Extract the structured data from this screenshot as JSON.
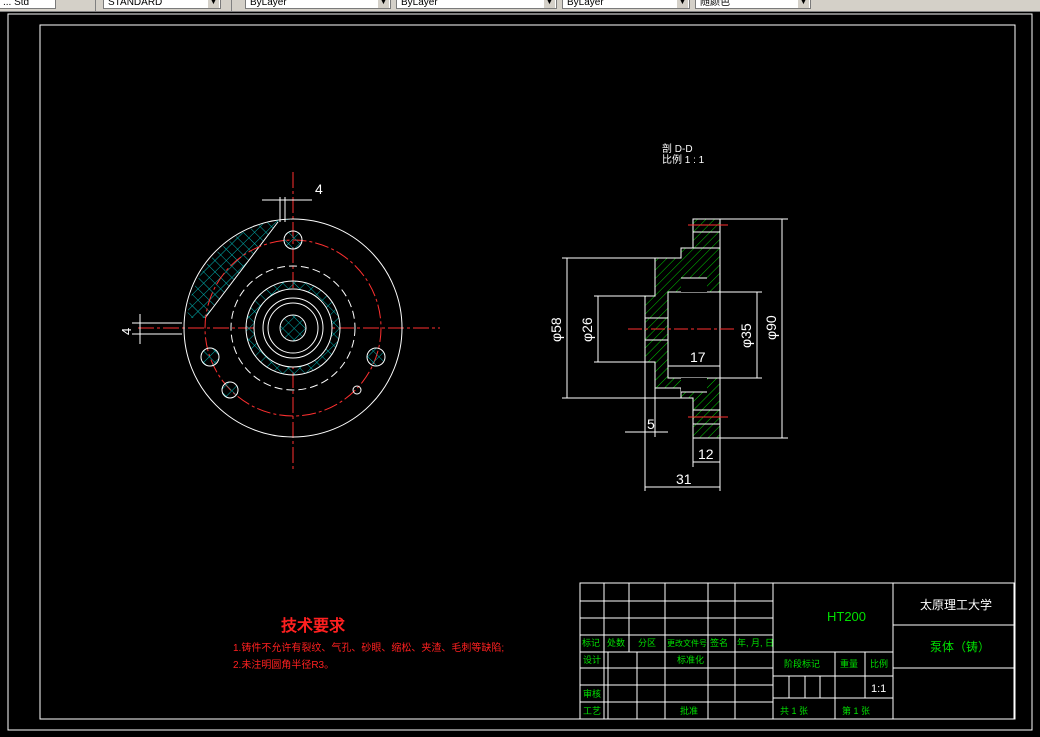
{
  "toolbar": {
    "items": [
      {
        "label": "... Std"
      },
      {
        "label": "STANDARD"
      },
      {
        "label": "ByLayer"
      },
      {
        "label": "ByLayer"
      },
      {
        "label": "ByLayer"
      },
      {
        "label": "随颜色"
      }
    ]
  },
  "drawing": {
    "section_title": "剖 D-D",
    "section_scale": "比例 1 : 1",
    "dims": {
      "d4_top": "4",
      "d4_left": "4",
      "phi58": "φ58",
      "phi26": "φ26",
      "phi35": "φ35",
      "phi90": "φ90",
      "d17": "17",
      "d5": "5",
      "d12": "12",
      "d31": "31"
    },
    "tech": {
      "title": "技术要求",
      "line1": "1.铸件不允许有裂纹、气孔、砂眼、缩松、夹渣、毛刺等缺陷;",
      "line2": "2.未注明圆角半径R3。"
    }
  },
  "titleblock": {
    "material": "HT200",
    "school": "太原理工大学",
    "part_name": "泵体（铸）",
    "h_biaoji": "标记",
    "h_chushu": "处数",
    "h_fenqu": "分区",
    "h_gengai": "更改文件号",
    "h_qianming": "签名",
    "h_date": "年, 月, 日",
    "sheji": "设计",
    "biaozhunhua": "标准化",
    "jieduan": "阶段标记",
    "zhongliang": "重量",
    "bili": "比例",
    "scale": "1:1",
    "shenhe": "审核",
    "gongyi": "工艺",
    "pizhun": "批准",
    "total": "共  1  张",
    "sheet": "第  1  张"
  }
}
